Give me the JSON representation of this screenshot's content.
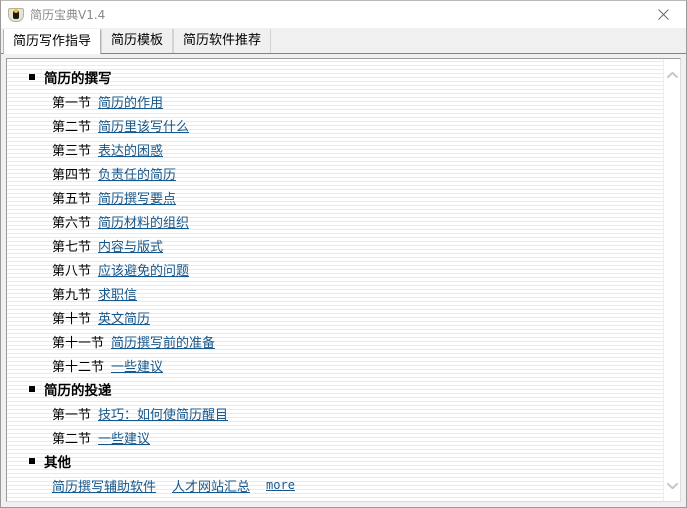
{
  "window": {
    "title": "简历宝典V1.4",
    "icon": "app-shield-icon",
    "close_label": "✕"
  },
  "tabs": [
    {
      "label": "简历写作指导",
      "active": true
    },
    {
      "label": "简历模板",
      "active": false
    },
    {
      "label": "简历软件推荐",
      "active": false
    }
  ],
  "colors": {
    "link": "#17578b",
    "title_text": "#8a8a8a",
    "window_border": "#9a9a9a",
    "tab_active_bg": "#ffffff",
    "tab_bg": "#f0f0f0",
    "content_bg": "#ffffff",
    "stripe": "#ebebeb"
  },
  "content": {
    "groups": [
      {
        "heading": "简历的撰写",
        "sections": [
          {
            "num": "第一节",
            "link": "简历的作用"
          },
          {
            "num": "第二节",
            "link": "简历里该写什么"
          },
          {
            "num": "第三节",
            "link": "表达的困惑"
          },
          {
            "num": "第四节",
            "link": "负责任的简历"
          },
          {
            "num": "第五节",
            "link": "简历撰写要点"
          },
          {
            "num": "第六节",
            "link": "简历材料的组织"
          },
          {
            "num": "第七节",
            "link": "内容与版式"
          },
          {
            "num": "第八节",
            "link": "应该避免的问题"
          },
          {
            "num": "第九节",
            "link": "求职信"
          },
          {
            "num": "第十节",
            "link": "英文简历"
          },
          {
            "num": "第十一节",
            "link": "简历撰写前的准备"
          },
          {
            "num": "第十二节",
            "link": "一些建议"
          }
        ]
      },
      {
        "heading": "简历的投递",
        "sections": [
          {
            "num": "第一节",
            "link": "技巧：如何使简历醒目"
          },
          {
            "num": "第二节",
            "link": "一些建议"
          }
        ]
      },
      {
        "heading": "其他",
        "sections": [],
        "links_row": [
          {
            "text": "简历撰写辅助软件",
            "mono": false
          },
          {
            "text": "人才网站汇总",
            "mono": false
          },
          {
            "text": "more",
            "mono": true
          }
        ]
      }
    ]
  },
  "scrollbar": {
    "up_icon": "chevron-up-icon",
    "down_icon": "chevron-down-icon"
  }
}
